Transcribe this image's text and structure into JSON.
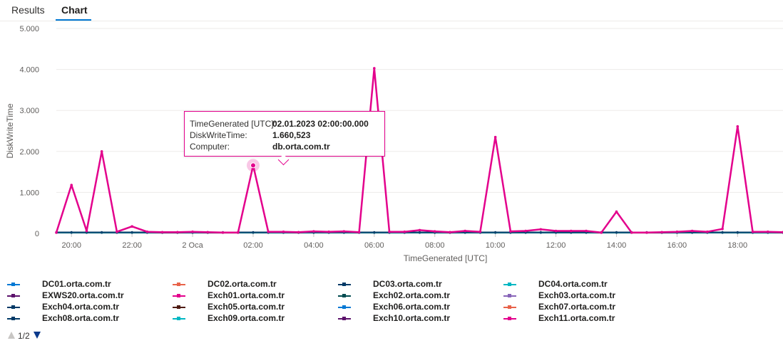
{
  "tabs": [
    {
      "label": "Results",
      "active": false
    },
    {
      "label": "Chart",
      "active": true
    }
  ],
  "colors": {
    "accent": "#0078d4",
    "highlight_series": "#e3008c"
  },
  "tooltip": {
    "rows": [
      {
        "label": "TimeGenerated [UTC]:",
        "value": "02.01.2023 02:00:00.000"
      },
      {
        "label": "DiskWriteTime:",
        "value": "1.660,523"
      },
      {
        "label": "Computer:",
        "value": "db.orta.com.tr"
      }
    ]
  },
  "pager": {
    "text": "1/2",
    "up_icon": "triangle-up-icon",
    "down_icon": "triangle-down-icon"
  },
  "chart_data": {
    "type": "line",
    "xlabel": "TimeGenerated [UTC]",
    "ylabel": "DiskWriteTime",
    "ylim": [
      0,
      5000
    ],
    "yticks": [
      "0",
      "1.000",
      "2.000",
      "3.000",
      "4.000",
      "5.000"
    ],
    "xlim": [
      19.5,
      43.5
    ],
    "xticks": [
      {
        "x": 20,
        "label": "20:00"
      },
      {
        "x": 22,
        "label": "22:00"
      },
      {
        "x": 24,
        "label": "2 Oca"
      },
      {
        "x": 26,
        "label": "02:00"
      },
      {
        "x": 28,
        "label": "04:00"
      },
      {
        "x": 30,
        "label": "06:00"
      },
      {
        "x": 32,
        "label": "08:00"
      },
      {
        "x": 34,
        "label": "10:00"
      },
      {
        "x": 36,
        "label": "12:00"
      },
      {
        "x": 38,
        "label": "14:00"
      },
      {
        "x": 40,
        "label": "16:00"
      },
      {
        "x": 42,
        "label": "18:00"
      }
    ],
    "grid": true,
    "legend_position": "bottom",
    "highlighted_point": {
      "x": 26,
      "y": 1660.523
    },
    "series": [
      {
        "name": "DC01.orta.com.tr",
        "color": "#0078d4",
        "values": [
          20,
          20,
          20,
          20,
          20,
          20,
          20,
          20,
          20,
          20,
          20,
          20,
          20,
          20,
          20,
          20,
          20,
          20,
          20,
          20,
          20,
          20,
          20,
          20,
          20,
          20,
          20,
          20,
          20,
          20,
          20,
          20,
          20,
          20,
          20,
          20,
          20,
          20,
          20,
          20,
          20,
          20,
          20,
          20,
          20,
          20,
          20,
          20,
          20,
          20,
          20
        ]
      },
      {
        "name": "DC02.orta.com.tr",
        "color": "#e8634a",
        "values": []
      },
      {
        "name": "DC03.orta.com.tr",
        "color": "#003966",
        "values": [
          15,
          15,
          15,
          15,
          15,
          15,
          15,
          15,
          15,
          15,
          15,
          15,
          15,
          15,
          15,
          15,
          15,
          15,
          15,
          15,
          15,
          15,
          15,
          15,
          15,
          15,
          15,
          15,
          15,
          15,
          15,
          15,
          15,
          15,
          15,
          15,
          15,
          15,
          15,
          15,
          15,
          15,
          15,
          15,
          15,
          15,
          15,
          15,
          15,
          15,
          15
        ]
      },
      {
        "name": "DC04.orta.com.tr",
        "color": "#00b7c3",
        "values": [
          25,
          25,
          25,
          25,
          25,
          25,
          25,
          25,
          25,
          25,
          25,
          25,
          25,
          25,
          25,
          25,
          25,
          25,
          25,
          25,
          25,
          25,
          25,
          25,
          25,
          25,
          25,
          25,
          25,
          25,
          25,
          25,
          25,
          25,
          25,
          25,
          25,
          25,
          25,
          25,
          25,
          25,
          25,
          25,
          25,
          25,
          25,
          25,
          25,
          25,
          25
        ]
      },
      {
        "name": "EXWS20.orta.com.tr",
        "color": "#5c126b",
        "values": []
      },
      {
        "name": "Exch01.orta.com.tr",
        "color": "#e3008c",
        "values": []
      },
      {
        "name": "Exch02.orta.com.tr",
        "color": "#004b50",
        "values": []
      },
      {
        "name": "Exch03.orta.com.tr",
        "color": "#8764b8",
        "values": []
      },
      {
        "name": "Exch04.orta.com.tr",
        "color": "#003966",
        "values": [
          30,
          30,
          30,
          30,
          30,
          30,
          30,
          30,
          30,
          30,
          30,
          30,
          30,
          30,
          30,
          30,
          30,
          30,
          30,
          30,
          30,
          30,
          30,
          30,
          30,
          30,
          30,
          30,
          30,
          30,
          30,
          30,
          30,
          30,
          30,
          30,
          30,
          30,
          30,
          30,
          30,
          30,
          30,
          30,
          30,
          30,
          30,
          30,
          30,
          30,
          30
        ]
      },
      {
        "name": "Exch05.orta.com.tr",
        "color": "#4f1c14",
        "values": []
      },
      {
        "name": "Exch06.orta.com.tr",
        "color": "#0078d4",
        "values": []
      },
      {
        "name": "Exch07.orta.com.tr",
        "color": "#e8634a",
        "values": []
      },
      {
        "name": "Exch08.orta.com.tr",
        "color": "#003966",
        "values": []
      },
      {
        "name": "Exch09.orta.com.tr",
        "color": "#00b7c3",
        "values": []
      },
      {
        "name": "Exch10.orta.com.tr",
        "color": "#5c126b",
        "values": []
      },
      {
        "name": "Exch11.orta.com.tr",
        "color": "#e3008c",
        "values": []
      },
      {
        "name": "",
        "color": "#e3008c",
        "values": [
          20,
          1180,
          60,
          2000,
          40,
          170,
          40,
          30,
          30,
          40,
          30,
          20,
          20,
          1660,
          40,
          40,
          30,
          50,
          40,
          50,
          30,
          4030,
          40,
          40,
          80,
          50,
          30,
          60,
          40,
          2350,
          50,
          60,
          100,
          60,
          60,
          60,
          20,
          530,
          20,
          20,
          30,
          40,
          60,
          40,
          110,
          2610,
          40,
          40,
          30,
          20,
          30
        ]
      }
    ],
    "x_start": 19.5,
    "x_step": 0.5
  }
}
